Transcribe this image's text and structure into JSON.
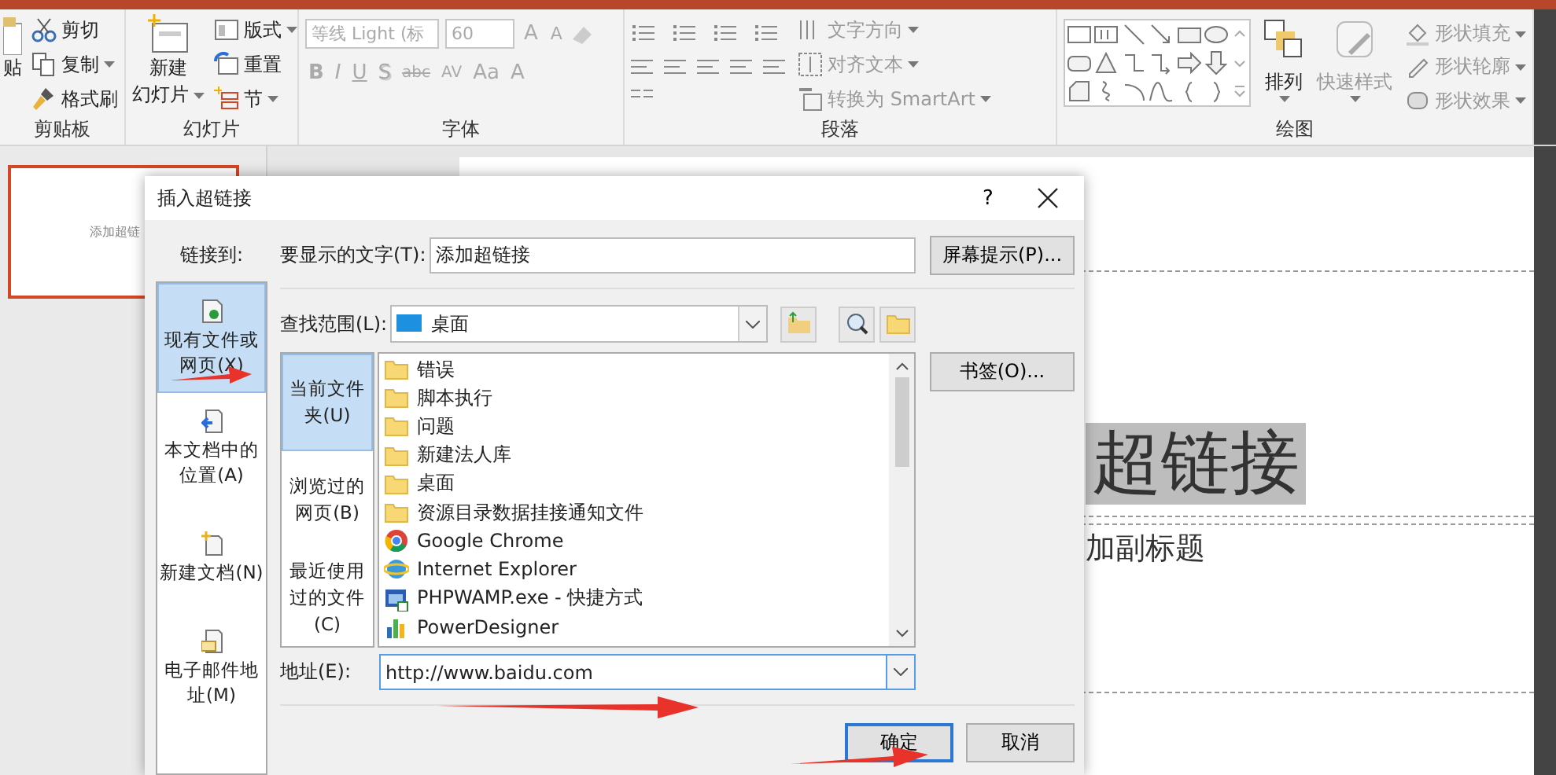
{
  "ribbon": {
    "clipboard": {
      "paste": "贴",
      "cut": "剪切",
      "copy": "复制",
      "format_painter": "格式刷",
      "label": "剪贴板"
    },
    "slides": {
      "new_slide": [
        "新建",
        "幻灯片"
      ],
      "layout": "版式",
      "reset": "重置",
      "section": "节",
      "label": "幻灯片"
    },
    "font": {
      "font_name": "等线 Light (标",
      "font_size": "60",
      "size_buttons": [
        "A",
        "A"
      ],
      "format_buttons": [
        {
          "text": "B",
          "kind": "bold"
        },
        {
          "text": "I",
          "kind": "italic"
        },
        {
          "text": "U",
          "kind": "underline"
        },
        {
          "text": "S",
          "kind": "shadow"
        },
        {
          "text": "abc",
          "kind": "strike"
        },
        {
          "text": "AV",
          "kind": "spacing"
        },
        {
          "text": "Aa",
          "kind": "case"
        },
        {
          "text": "A",
          "kind": "color"
        }
      ],
      "label": "字体"
    },
    "paragraph": {
      "text_direction": "文字方向",
      "align_text": "对齐文本",
      "smartart": "转换为 SmartArt",
      "label": "段落"
    },
    "drawing": {
      "arrange": "排列",
      "quick_styles": "快速样式",
      "shape_fill": "形状填充",
      "shape_outline": "形状轮廓",
      "shape_effects": "形状效果",
      "label": "绘图"
    }
  },
  "thumbnail_text": "添加超链",
  "slide": {
    "title": "超链接",
    "subtitle": "加副标题"
  },
  "dialog": {
    "title": "插入超链接",
    "help": "?",
    "link_to_label": "链接到:",
    "link_to": [
      {
        "label": "现有文件或网页(X)",
        "selected": true,
        "kind": "file"
      },
      {
        "label": "本文档中的位置(A)",
        "selected": false,
        "kind": "place"
      },
      {
        "label": "新建文档(N)",
        "selected": false,
        "kind": "new"
      },
      {
        "label": "电子邮件地址(M)",
        "selected": false,
        "kind": "email"
      }
    ],
    "display_text_label": "要显示的文字(T):",
    "display_text": "添加超链接",
    "screentip_button": "屏幕提示(P)...",
    "look_in_label": "查找范围(L):",
    "look_in": "桌面",
    "browse_tabs": [
      {
        "label": "当前文件夹(U)",
        "selected": true
      },
      {
        "label": "浏览过的网页(B)",
        "selected": false
      },
      {
        "label": "最近使用过的文件(C)",
        "selected": false
      }
    ],
    "files": [
      {
        "name": "错误",
        "kind": "folder"
      },
      {
        "name": "脚本执行",
        "kind": "folder"
      },
      {
        "name": "问题",
        "kind": "folder"
      },
      {
        "name": "新建法人库",
        "kind": "folder"
      },
      {
        "name": "桌面",
        "kind": "folder"
      },
      {
        "name": "资源目录数据挂接通知文件",
        "kind": "folder"
      },
      {
        "name": "Google Chrome",
        "kind": "chrome"
      },
      {
        "name": "Internet Explorer",
        "kind": "ie"
      },
      {
        "name": "PHPWAMP.exe - 快捷方式",
        "kind": "shortcut"
      },
      {
        "name": "PowerDesigner",
        "kind": "app"
      }
    ],
    "bookmark_button": "书签(O)...",
    "address_label": "地址(E):",
    "address": "http://www.baidu.com",
    "ok_button": "确定",
    "cancel_button": "取消"
  }
}
